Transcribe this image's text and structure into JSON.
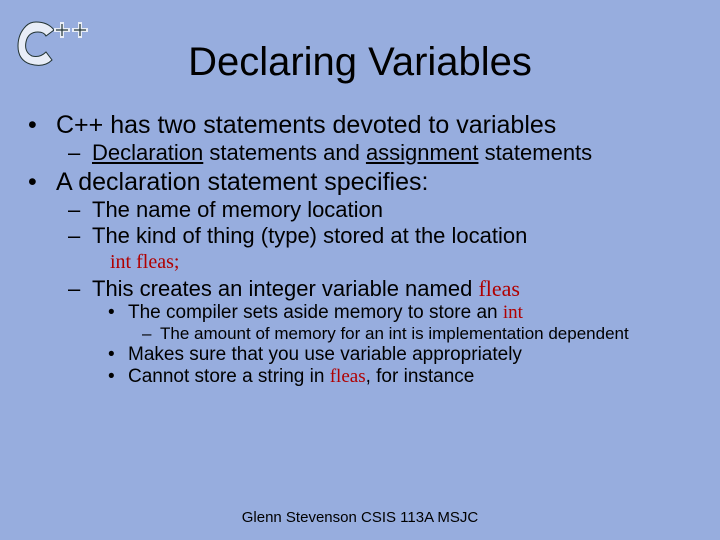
{
  "title": "Declaring Variables",
  "b1": {
    "text": "C++ has two statements devoted to variables",
    "sub": {
      "pre": "",
      "u1": "Declaration",
      "mid": " statements and ",
      "u2": "assignment",
      "post": " statements"
    }
  },
  "b2": {
    "text": "A declaration statement specifies:",
    "s1": "The name of memory location",
    "s2": "The kind of thing (type) stored at the location",
    "code": "int fleas;",
    "s3": {
      "pre": "This creates an integer variable named ",
      "kw": "fleas"
    },
    "s3a": {
      "pre": "The compiler sets aside memory to store an ",
      "kw": "int"
    },
    "s3a1": "The amount of memory for an int is implementation dependent",
    "s3b": "Makes sure that you use variable appropriately",
    "s3c": {
      "pre": "Cannot store a string in ",
      "kw": "fleas",
      "post": ", for instance"
    }
  },
  "footer": "Glenn Stevenson CSIS 113A MSJC"
}
